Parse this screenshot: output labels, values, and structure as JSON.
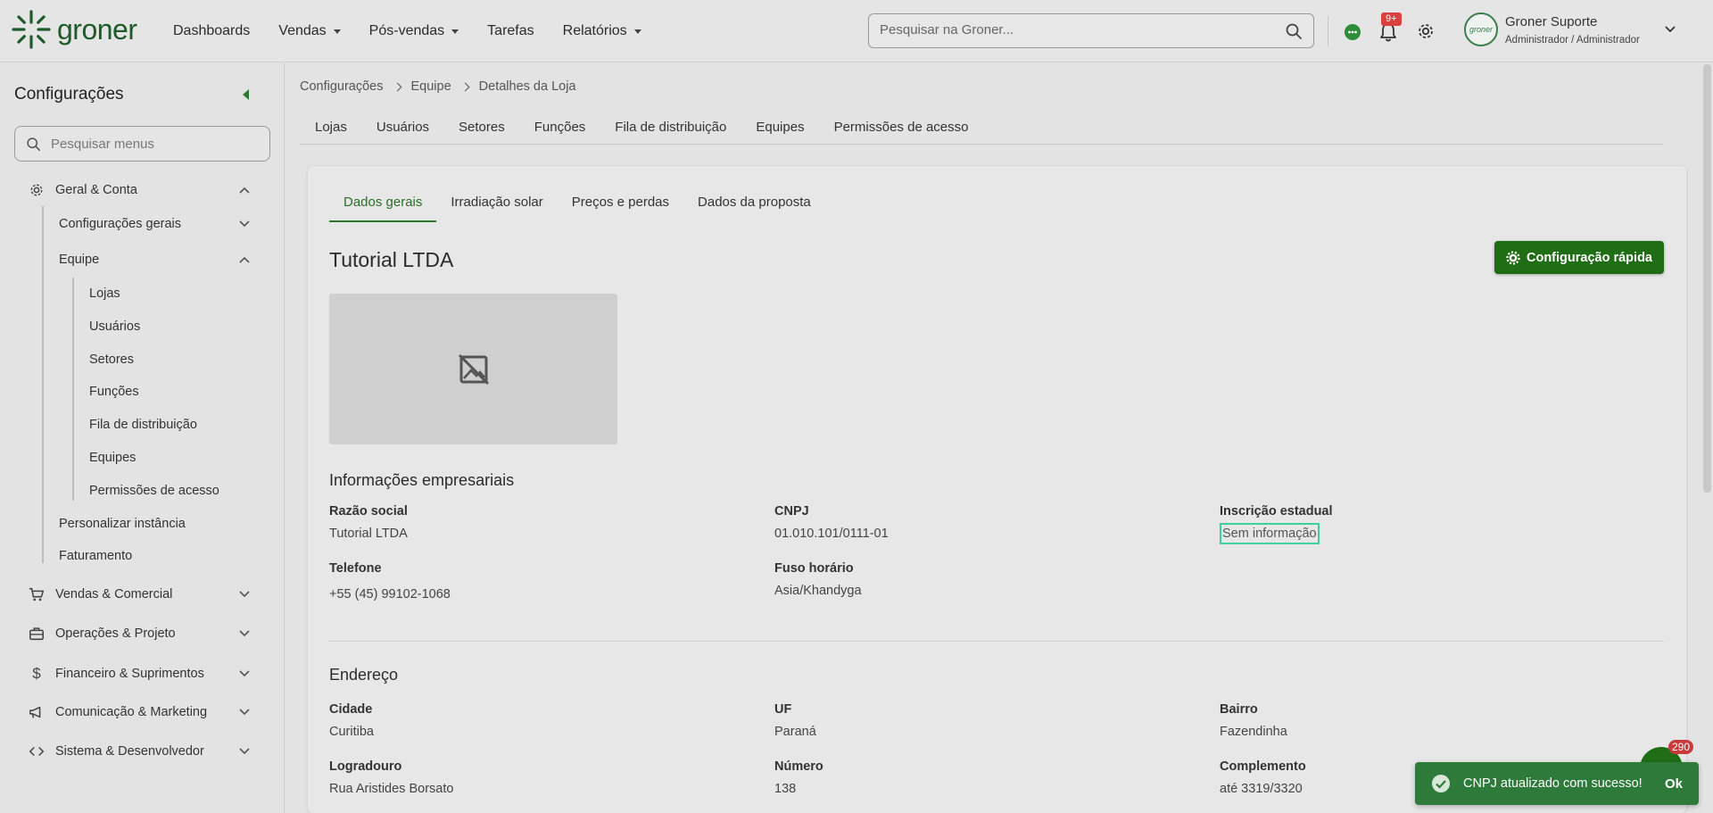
{
  "app": {
    "logo_text": "groner"
  },
  "topnav": {
    "items": [
      {
        "label": "Dashboards",
        "dropdown": false
      },
      {
        "label": "Vendas",
        "dropdown": true
      },
      {
        "label": "Pós-vendas",
        "dropdown": true
      },
      {
        "label": "Tarefas",
        "dropdown": false
      },
      {
        "label": "Relatórios",
        "dropdown": true
      }
    ],
    "search_placeholder": "Pesquisar na Groner...",
    "notifications_badge": "9+",
    "user_name": "Groner Suporte",
    "user_role": "Administrador / Administrador",
    "avatar_text": "groner"
  },
  "sidebar": {
    "title": "Configurações",
    "search_placeholder": "Pesquisar menus",
    "sections": {
      "geral": "Geral & Conta",
      "config_gerais": "Configurações gerais",
      "equipe": "Equipe",
      "lojas": "Lojas",
      "usuarios": "Usuários",
      "setores": "Setores",
      "funcoes": "Funções",
      "fila": "Fila de distribuição",
      "equipes": "Equipes",
      "permissoes": "Permissões de acesso",
      "personalizar": "Personalizar instância",
      "faturamento": "Faturamento",
      "vendas": "Vendas & Comercial",
      "operacoes": "Operações & Projeto",
      "financeiro": "Financeiro & Suprimentos",
      "comunicacao": "Comunicação & Marketing",
      "sistema": "Sistema & Desenvolvedor"
    }
  },
  "breadcrumb": [
    "Configurações",
    "Equipe",
    "Detalhes da Loja"
  ],
  "tabs": [
    "Lojas",
    "Usuários",
    "Setores",
    "Funções",
    "Fila de distribuição",
    "Equipes",
    "Permissões de acesso"
  ],
  "card": {
    "tabs": [
      "Dados gerais",
      "Irradiação solar",
      "Preços e perdas",
      "Dados da proposta"
    ],
    "active_tab": "Dados gerais",
    "title": "Tutorial LTDA",
    "quick_config_label": "Configuração rápida",
    "business_info": {
      "title": "Informações empresariais",
      "razao_social_label": "Razão social",
      "razao_social": "Tutorial LTDA",
      "cnpj_label": "CNPJ",
      "cnpj": "01.010.101/0111-01",
      "ie_label": "Inscrição estadual",
      "ie": "Sem informação",
      "telefone_label": "Telefone",
      "telefone": "+55 (45) 99102-1068",
      "fuso_label": "Fuso horário",
      "fuso": "Asia/Khandyga"
    },
    "address": {
      "title": "Endereço",
      "cidade_label": "Cidade",
      "cidade": "Curitiba",
      "uf_label": "UF",
      "uf": "Paraná",
      "bairro_label": "Bairro",
      "bairro": "Fazendinha",
      "logradouro_label": "Logradouro",
      "logradouro": "Rua Aristides Borsato",
      "numero_label": "Número",
      "numero": "138",
      "complemento_label": "Complemento",
      "complemento": "até 3319/3320"
    }
  },
  "toast": {
    "message": "CNPJ atualizado com sucesso!",
    "action": "Ok"
  },
  "chat_count": "290",
  "colors": {
    "brand_green": "#1f6e16",
    "active_tab": "#2a6e2a",
    "toast_bg": "#2d7a3a",
    "badge_red": "#d94040",
    "focus_border": "#3ecf9a"
  }
}
